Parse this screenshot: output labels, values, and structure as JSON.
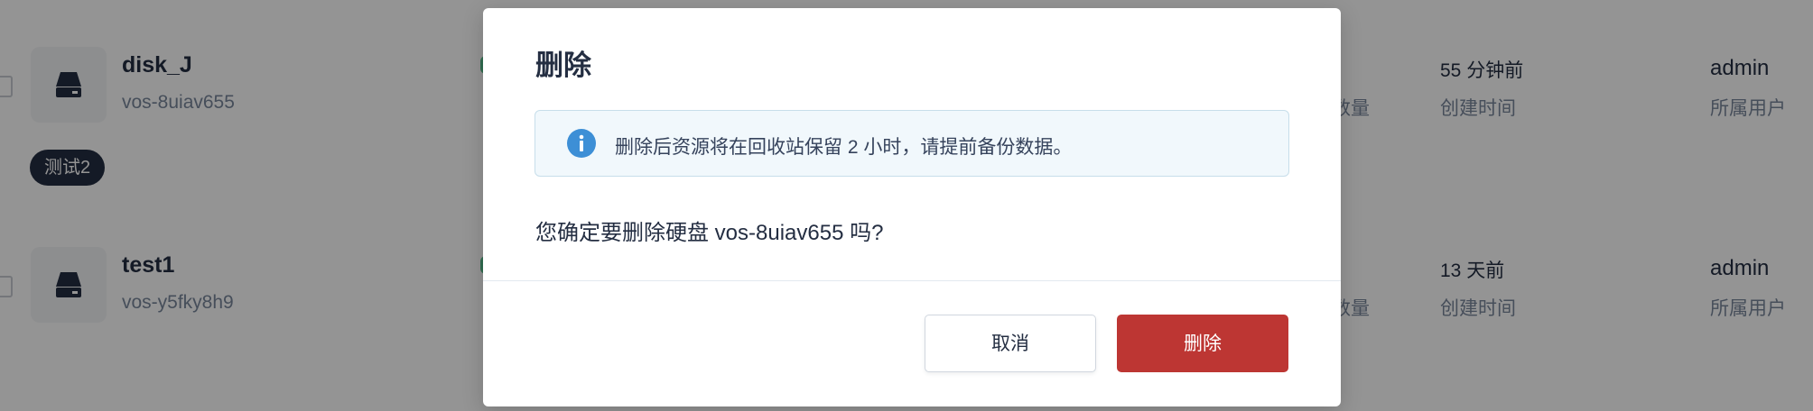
{
  "list": {
    "rows": [
      {
        "name": "disk_J",
        "id": "vos-8uiav655",
        "tag": "测试2",
        "col_label_left": "数量",
        "time_value": "55 分钟前",
        "time_label": "创建时间",
        "owner_value": "admin",
        "owner_label": "所属用户"
      },
      {
        "name": "test1",
        "id": "vos-y5fky8h9",
        "col_label_left": "数量",
        "time_value": "13 天前",
        "time_label": "创建时间",
        "owner_value": "admin",
        "owner_label": "所属用户"
      }
    ]
  },
  "modal": {
    "title": "删除",
    "info_text": "删除后资源将在回收站保留 2 小时，请提前备份数据。",
    "confirm_text": "您确定要删除硬盘 vos-8uiav655 吗?",
    "cancel_label": "取消",
    "delete_label": "删除"
  },
  "colors": {
    "danger": "#bd3633",
    "info_icon": "#3d8fd6",
    "info_bg": "#f1f8fc",
    "text_primary": "#242e42",
    "text_secondary": "#79879c"
  },
  "icons": {
    "disk": "disk-icon",
    "info": "info-icon"
  }
}
